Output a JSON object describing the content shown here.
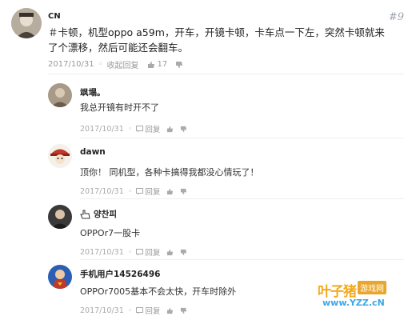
{
  "main": {
    "user": "CN",
    "floor": "#9",
    "text": "＃卡顿，机型oppo a59m，开车，开镜卡顿，卡车点一下左，突然卡顿就来了个漂移，然后可能还会翻车。",
    "date": "2017/10/31",
    "collapse_label": "收起回复",
    "likes": "17"
  },
  "replies": [
    {
      "user": "飒塌。",
      "text": "我总开镜有时开不了",
      "date": "2017/10/31",
      "reply_label": "回复",
      "avatar_color": "#a89a86"
    },
    {
      "user": "dawn",
      "text": "顶你！ 同机型，各种卡搞得我都没心情玩了！",
      "date": "2017/10/31",
      "reply_label": "回复",
      "avatar_color": "#c0392b"
    },
    {
      "user": "양찬피",
      "text": "OPPOr7一股卡",
      "date": "2017/10/31",
      "reply_label": "回复",
      "avatar_color": "#2b2b2b"
    },
    {
      "user": "手机用户14526496",
      "text": "OPPOr7005基本不会太快，开车时除外",
      "date": "2017/10/31",
      "reply_label": "回复",
      "avatar_color": "#c0392b"
    }
  ],
  "watermark": {
    "main": "叶子猪",
    "tag": "游戏网",
    "url": "www.YZZ.cN"
  },
  "colors": {
    "accent": "#f3a91c",
    "link": "#3ba8e6"
  }
}
